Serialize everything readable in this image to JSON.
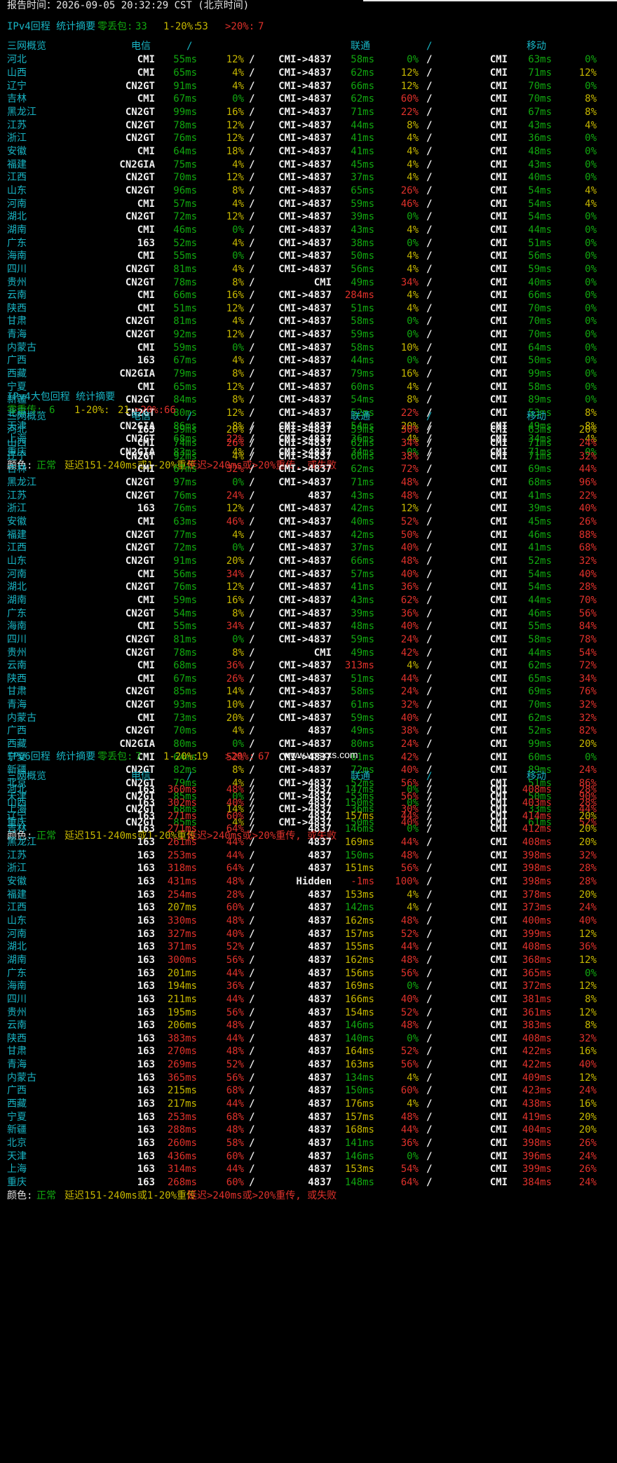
{
  "report_time": "报告时间：2026-09-05 20:32:29 CST (北京时间)",
  "watermark": "www.vpsxxs.com",
  "legend": {
    "label": "颜色:",
    "normal": "正常",
    "mid": "延迟151-240ms或1-20%重传",
    "bad": "延迟>240ms或>20%重传, 或失败"
  },
  "sections": [
    {
      "title": "IPv4回程 统计摘要",
      "summary_label_good": "零丢包:",
      "summary_good": "33",
      "summary_label_mid": "1-20%:",
      "summary_mid": "53",
      "summary_label_bad": ">20%:",
      "summary_bad": "7",
      "headers": [
        "三网概览",
        "电信",
        "/",
        "联通",
        "/",
        "移动"
      ],
      "rows": [
        [
          "河北",
          "CMI",
          "55ms",
          "12%",
          "CMI->4837",
          "58ms",
          "0%",
          "CMI",
          "63ms",
          "0%"
        ],
        [
          "山西",
          "CMI",
          "65ms",
          "4%",
          "CMI->4837",
          "62ms",
          "12%",
          "CMI",
          "71ms",
          "12%"
        ],
        [
          "辽宁",
          "CN2GT",
          "91ms",
          "4%",
          "CMI->4837",
          "66ms",
          "12%",
          "CMI",
          "70ms",
          "0%"
        ],
        [
          "吉林",
          "CMI",
          "67ms",
          "0%",
          "CMI->4837",
          "62ms",
          "60%",
          "CMI",
          "70ms",
          "8%"
        ],
        [
          "黑龙江",
          "CN2GT",
          "99ms",
          "16%",
          "CMI->4837",
          "71ms",
          "22%",
          "CMI",
          "67ms",
          "8%"
        ],
        [
          "江苏",
          "CN2GT",
          "78ms",
          "12%",
          "CMI->4837",
          "44ms",
          "8%",
          "CMI",
          "43ms",
          "4%"
        ],
        [
          "浙江",
          "CN2GT",
          "76ms",
          "12%",
          "CMI->4837",
          "41ms",
          "4%",
          "CMI",
          "36ms",
          "0%"
        ],
        [
          "安徽",
          "CMI",
          "64ms",
          "18%",
          "CMI->4837",
          "41ms",
          "4%",
          "CMI",
          "48ms",
          "0%"
        ],
        [
          "福建",
          "CN2GIA",
          "75ms",
          "4%",
          "CMI->4837",
          "45ms",
          "4%",
          "CMI",
          "43ms",
          "0%"
        ],
        [
          "江西",
          "CN2GT",
          "70ms",
          "12%",
          "CMI->4837",
          "37ms",
          "4%",
          "CMI",
          "40ms",
          "0%"
        ],
        [
          "山东",
          "CN2GT",
          "96ms",
          "8%",
          "CMI->4837",
          "65ms",
          "26%",
          "CMI",
          "54ms",
          "4%"
        ],
        [
          "河南",
          "CMI",
          "57ms",
          "4%",
          "CMI->4837",
          "59ms",
          "46%",
          "CMI",
          "54ms",
          "4%"
        ],
        [
          "湖北",
          "CN2GT",
          "72ms",
          "12%",
          "CMI->4837",
          "39ms",
          "0%",
          "CMI",
          "54ms",
          "0%"
        ],
        [
          "湖南",
          "CMI",
          "46ms",
          "0%",
          "CMI->4837",
          "43ms",
          "4%",
          "CMI",
          "44ms",
          "0%"
        ],
        [
          "广东",
          "163",
          "52ms",
          "4%",
          "CMI->4837",
          "38ms",
          "0%",
          "CMI",
          "51ms",
          "0%"
        ],
        [
          "海南",
          "CMI",
          "55ms",
          "0%",
          "CMI->4837",
          "50ms",
          "4%",
          "CMI",
          "56ms",
          "0%"
        ],
        [
          "四川",
          "CN2GT",
          "81ms",
          "4%",
          "CMI->4837",
          "56ms",
          "4%",
          "CMI",
          "59ms",
          "0%"
        ],
        [
          "贵州",
          "CN2GT",
          "78ms",
          "8%",
          "CMI",
          "49ms",
          "34%",
          "CMI",
          "40ms",
          "0%"
        ],
        [
          "云南",
          "CMI",
          "66ms",
          "16%",
          "CMI->4837",
          "284ms",
          "4%",
          "CMI",
          "66ms",
          "0%"
        ],
        [
          "陕西",
          "CMI",
          "51ms",
          "12%",
          "CMI->4837",
          "51ms",
          "4%",
          "CMI",
          "70ms",
          "0%"
        ],
        [
          "甘肃",
          "CN2GT",
          "81ms",
          "4%",
          "CMI->4837",
          "58ms",
          "0%",
          "CMI",
          "70ms",
          "0%"
        ],
        [
          "青海",
          "CN2GT",
          "92ms",
          "12%",
          "CMI->4837",
          "59ms",
          "0%",
          "CMI",
          "70ms",
          "0%"
        ],
        [
          "内蒙古",
          "CMI",
          "59ms",
          "0%",
          "CMI->4837",
          "58ms",
          "10%",
          "CMI",
          "64ms",
          "0%"
        ],
        [
          "广西",
          "163",
          "67ms",
          "4%",
          "CMI->4837",
          "44ms",
          "0%",
          "CMI",
          "50ms",
          "0%"
        ],
        [
          "西藏",
          "CN2GIA",
          "79ms",
          "8%",
          "CMI->4837",
          "79ms",
          "16%",
          "CMI",
          "99ms",
          "0%"
        ],
        [
          "宁夏",
          "CMI",
          "65ms",
          "12%",
          "CMI->4837",
          "60ms",
          "4%",
          "CMI",
          "58ms",
          "0%"
        ],
        [
          "新疆",
          "CN2GT",
          "84ms",
          "8%",
          "CMI->4837",
          "54ms",
          "8%",
          "CMI",
          "89ms",
          "0%"
        ],
        [
          "北京",
          "CN2GT",
          "80ms",
          "12%",
          "CMI->4837",
          "52ms",
          "22%",
          "CMI",
          "53ms",
          "8%"
        ],
        [
          "天津",
          "CN2GIA",
          "86ms",
          "8%",
          "CMI->4837",
          "54ms",
          "20%",
          "CMI",
          "49ms",
          "8%"
        ],
        [
          "上海",
          "CN2GT",
          "68ms",
          "22%",
          "CMI->4837",
          "36ms",
          "4%",
          "CMI",
          "34ms",
          "4%"
        ],
        [
          "重庆",
          "CN2GIA",
          "83ms",
          "4%",
          "CMI->4837",
          "34ms",
          "0%",
          "CMI",
          "71ms",
          "0%"
        ]
      ]
    },
    {
      "title": "IPv4大包回程 统计摘要",
      "summary_label_good": "零重传:",
      "summary_good": "6",
      "summary_label_mid": "1-20%:",
      "summary_mid": "21",
      "summary_label_bad": ">20%:",
      "summary_bad": "66",
      "headers": [
        "三网概览",
        "电信",
        "/",
        "联通",
        "/",
        "移动"
      ],
      "rows": [
        [
          "河北",
          "163",
          "59ms",
          "20%",
          "CMI->4837",
          "59ms",
          "30%",
          "CMI",
          "63ms",
          "20%"
        ],
        [
          "山西",
          "CMI",
          "74ms",
          "26%",
          "CMI->4837",
          "62ms",
          "34%",
          "CMI",
          "71ms",
          "24%"
        ],
        [
          "辽宁",
          "CN2GT",
          "92ms",
          "4%",
          "CMI->4837",
          "66ms",
          "38%",
          "CMI",
          "71ms",
          "32%"
        ],
        [
          "吉林",
          "CMI",
          "67ms",
          "32%",
          "CMI->4837",
          "62ms",
          "72%",
          "CMI",
          "69ms",
          "44%"
        ],
        [
          "黑龙江",
          "CN2GT",
          "97ms",
          "0%",
          "CMI->4837",
          "71ms",
          "48%",
          "CMI",
          "68ms",
          "96%"
        ],
        [
          "江苏",
          "CN2GT",
          "76ms",
          "24%",
          "4837",
          "43ms",
          "48%",
          "CMI",
          "41ms",
          "22%"
        ],
        [
          "浙江",
          "163",
          "76ms",
          "12%",
          "CMI->4837",
          "42ms",
          "12%",
          "CMI",
          "39ms",
          "40%"
        ],
        [
          "安徽",
          "CMI",
          "63ms",
          "46%",
          "CMI->4837",
          "40ms",
          "52%",
          "CMI",
          "45ms",
          "26%"
        ],
        [
          "福建",
          "CN2GT",
          "77ms",
          "4%",
          "CMI->4837",
          "42ms",
          "50%",
          "CMI",
          "46ms",
          "88%"
        ],
        [
          "江西",
          "CN2GT",
          "72ms",
          "0%",
          "CMI->4837",
          "37ms",
          "40%",
          "CMI",
          "41ms",
          "68%"
        ],
        [
          "山东",
          "CN2GT",
          "91ms",
          "20%",
          "CMI->4837",
          "66ms",
          "48%",
          "CMI",
          "52ms",
          "32%"
        ],
        [
          "河南",
          "CMI",
          "56ms",
          "34%",
          "CMI->4837",
          "57ms",
          "40%",
          "CMI",
          "54ms",
          "40%"
        ],
        [
          "湖北",
          "CN2GT",
          "76ms",
          "12%",
          "CMI->4837",
          "41ms",
          "36%",
          "CMI",
          "54ms",
          "28%"
        ],
        [
          "湖南",
          "CMI",
          "59ms",
          "16%",
          "CMI->4837",
          "43ms",
          "62%",
          "CMI",
          "44ms",
          "70%"
        ],
        [
          "广东",
          "CN2GT",
          "54ms",
          "8%",
          "CMI->4837",
          "39ms",
          "36%",
          "CMI",
          "46ms",
          "56%"
        ],
        [
          "海南",
          "CMI",
          "55ms",
          "34%",
          "CMI->4837",
          "48ms",
          "40%",
          "CMI",
          "55ms",
          "84%"
        ],
        [
          "四川",
          "CN2GT",
          "81ms",
          "0%",
          "CMI->4837",
          "59ms",
          "24%",
          "CMI",
          "58ms",
          "78%"
        ],
        [
          "贵州",
          "CN2GT",
          "78ms",
          "8%",
          "CMI",
          "49ms",
          "42%",
          "CMI",
          "44ms",
          "54%"
        ],
        [
          "云南",
          "CMI",
          "68ms",
          "36%",
          "CMI->4837",
          "313ms",
          "4%",
          "CMI",
          "62ms",
          "72%"
        ],
        [
          "陕西",
          "CMI",
          "67ms",
          "26%",
          "CMI->4837",
          "51ms",
          "44%",
          "CMI",
          "65ms",
          "34%"
        ],
        [
          "甘肃",
          "CN2GT",
          "85ms",
          "14%",
          "CMI->4837",
          "58ms",
          "24%",
          "CMI",
          "69ms",
          "76%"
        ],
        [
          "青海",
          "CN2GT",
          "93ms",
          "10%",
          "CMI->4837",
          "61ms",
          "32%",
          "CMI",
          "70ms",
          "32%"
        ],
        [
          "内蒙古",
          "CMI",
          "73ms",
          "20%",
          "CMI->4837",
          "59ms",
          "40%",
          "CMI",
          "62ms",
          "32%"
        ],
        [
          "广西",
          "CN2GT",
          "70ms",
          "4%",
          "4837",
          "49ms",
          "38%",
          "CMI",
          "52ms",
          "82%"
        ],
        [
          "西藏",
          "CN2GIA",
          "80ms",
          "0%",
          "CMI->4837",
          "80ms",
          "24%",
          "CMI",
          "99ms",
          "20%"
        ],
        [
          "宁夏",
          "CMI",
          "64ms",
          "52%",
          "CMI->4837",
          "61ms",
          "42%",
          "CMI",
          "60ms",
          "0%"
        ],
        [
          "新疆",
          "CN2GT",
          "82ms",
          "8%",
          "CMI->4837",
          "72ms",
          "40%",
          "CMI",
          "89ms",
          "24%"
        ],
        [
          "北京",
          "CN2GT",
          "79ms",
          "4%",
          "CMI->4837",
          "52ms",
          "56%",
          "CMI",
          "51ms",
          "86%"
        ],
        [
          "天津",
          "CN2GT",
          "85ms",
          "0%",
          "CMI->4837",
          "53ms",
          "56%",
          "CMI",
          "50ms",
          "90%"
        ],
        [
          "上海",
          "CN2GT",
          "68ms",
          "14%",
          "CMI->4837",
          "36ms",
          "30%",
          "CMI",
          "33ms",
          "44%"
        ],
        [
          "重庆",
          "CN2GT",
          "85ms",
          "4%",
          "CMI->4837",
          "50ms",
          "40%",
          "CMI",
          "61ms",
          "52%"
        ]
      ]
    },
    {
      "title": "IPv6回程 统计摘要",
      "summary_label_good": "零丢包:",
      "summary_good": "7",
      "summary_label_mid": "1-20%:",
      "summary_mid": "19",
      "summary_label_bad": ">20%:",
      "summary_bad": "67",
      "headers": [
        "三网概览",
        "电信",
        "/",
        "联通",
        "/",
        "移动"
      ],
      "rows": [
        [
          "河北",
          "163",
          "360ms",
          "48%",
          "4837",
          "147ms",
          "0%",
          "CMI",
          "408ms",
          "28%"
        ],
        [
          "山西",
          "163",
          "302ms",
          "40%",
          "4837",
          "150ms",
          "0%",
          "CMI",
          "403ms",
          "28%"
        ],
        [
          "辽宁",
          "163",
          "271ms",
          "60%",
          "4837",
          "157ms",
          "44%",
          "CMI",
          "414ms",
          "20%"
        ],
        [
          "吉林",
          "163",
          "271ms",
          "64%",
          "4837",
          "146ms",
          "0%",
          "CMI",
          "412ms",
          "20%"
        ],
        [
          "黑龙江",
          "163",
          "261ms",
          "44%",
          "4837",
          "169ms",
          "44%",
          "CMI",
          "408ms",
          "20%"
        ],
        [
          "江苏",
          "163",
          "253ms",
          "44%",
          "4837",
          "150ms",
          "48%",
          "CMI",
          "398ms",
          "32%"
        ],
        [
          "浙江",
          "163",
          "318ms",
          "64%",
          "4837",
          "151ms",
          "56%",
          "CMI",
          "398ms",
          "28%"
        ],
        [
          "安徽",
          "163",
          "431ms",
          "48%",
          "Hidden",
          "-1ms",
          "100%",
          "CMI",
          "398ms",
          "28%"
        ],
        [
          "福建",
          "163",
          "254ms",
          "28%",
          "4837",
          "153ms",
          "4%",
          "CMI",
          "378ms",
          "20%"
        ],
        [
          "江西",
          "163",
          "207ms",
          "60%",
          "4837",
          "142ms",
          "4%",
          "CMI",
          "373ms",
          "24%"
        ],
        [
          "山东",
          "163",
          "330ms",
          "48%",
          "4837",
          "162ms",
          "48%",
          "CMI",
          "400ms",
          "40%"
        ],
        [
          "河南",
          "163",
          "327ms",
          "40%",
          "4837",
          "157ms",
          "52%",
          "CMI",
          "399ms",
          "12%"
        ],
        [
          "湖北",
          "163",
          "371ms",
          "52%",
          "4837",
          "155ms",
          "44%",
          "CMI",
          "408ms",
          "36%"
        ],
        [
          "湖南",
          "163",
          "300ms",
          "56%",
          "4837",
          "162ms",
          "48%",
          "CMI",
          "368ms",
          "12%"
        ],
        [
          "广东",
          "163",
          "201ms",
          "44%",
          "4837",
          "156ms",
          "56%",
          "CMI",
          "365ms",
          "0%"
        ],
        [
          "海南",
          "163",
          "194ms",
          "36%",
          "4837",
          "169ms",
          "0%",
          "CMI",
          "372ms",
          "12%"
        ],
        [
          "四川",
          "163",
          "211ms",
          "44%",
          "4837",
          "166ms",
          "40%",
          "CMI",
          "381ms",
          "8%"
        ],
        [
          "贵州",
          "163",
          "195ms",
          "56%",
          "4837",
          "154ms",
          "52%",
          "CMI",
          "361ms",
          "12%"
        ],
        [
          "云南",
          "163",
          "206ms",
          "48%",
          "4837",
          "146ms",
          "48%",
          "CMI",
          "383ms",
          "8%"
        ],
        [
          "陕西",
          "163",
          "383ms",
          "44%",
          "4837",
          "140ms",
          "0%",
          "CMI",
          "408ms",
          "32%"
        ],
        [
          "甘肃",
          "163",
          "270ms",
          "48%",
          "4837",
          "164ms",
          "52%",
          "CMI",
          "422ms",
          "16%"
        ],
        [
          "青海",
          "163",
          "269ms",
          "52%",
          "4837",
          "163ms",
          "56%",
          "CMI",
          "422ms",
          "40%"
        ],
        [
          "内蒙古",
          "163",
          "365ms",
          "56%",
          "4837",
          "134ms",
          "4%",
          "CMI",
          "409ms",
          "12%"
        ],
        [
          "广西",
          "163",
          "215ms",
          "68%",
          "4837",
          "150ms",
          "60%",
          "CMI",
          "423ms",
          "24%"
        ],
        [
          "西藏",
          "163",
          "217ms",
          "44%",
          "4837",
          "176ms",
          "4%",
          "CMI",
          "438ms",
          "16%"
        ],
        [
          "宁夏",
          "163",
          "253ms",
          "68%",
          "4837",
          "157ms",
          "48%",
          "CMI",
          "419ms",
          "20%"
        ],
        [
          "新疆",
          "163",
          "288ms",
          "48%",
          "4837",
          "168ms",
          "44%",
          "CMI",
          "404ms",
          "20%"
        ],
        [
          "北京",
          "163",
          "260ms",
          "58%",
          "4837",
          "141ms",
          "36%",
          "CMI",
          "398ms",
          "26%"
        ],
        [
          "天津",
          "163",
          "436ms",
          "60%",
          "4837",
          "146ms",
          "0%",
          "CMI",
          "396ms",
          "24%"
        ],
        [
          "上海",
          "163",
          "314ms",
          "44%",
          "4837",
          "153ms",
          "54%",
          "CMI",
          "399ms",
          "26%"
        ],
        [
          "重庆",
          "163",
          "268ms",
          "60%",
          "4837",
          "148ms",
          "64%",
          "CMI",
          "384ms",
          "24%"
        ]
      ]
    }
  ]
}
